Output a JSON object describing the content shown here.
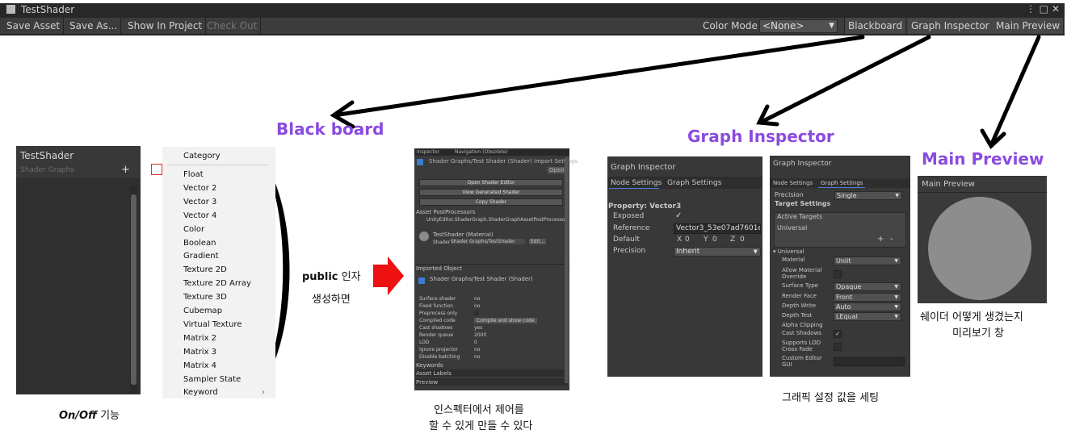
{
  "window": {
    "title": "TestShader"
  },
  "toolbar": {
    "save_asset": "Save Asset",
    "save_as": "Save As...",
    "show_in_project": "Show In Project",
    "check_out": "Check Out",
    "color_mode_label": "Color Mode",
    "color_mode_value": "<None>",
    "blackboard": "Blackboard",
    "graph_inspector": "Graph Inspector",
    "main_preview": "Main Preview"
  },
  "headings": {
    "blackboard": "Black board",
    "graph_inspector": "Graph Inspector",
    "main_preview": "Main Preview"
  },
  "blackboard_panel": {
    "title": "TestShader",
    "subtitle": "Shader Graphs",
    "add": "+"
  },
  "menu": {
    "header": "Category",
    "items": [
      "Float",
      "Vector 2",
      "Vector 3",
      "Vector 4",
      "Color",
      "Boolean",
      "Gradient",
      "Texture 2D",
      "Texture 2D Array",
      "Texture 3D",
      "Cubemap",
      "Virtual Texture",
      "Matrix 2",
      "Matrix 3",
      "Matrix 4",
      "Sampler State",
      "Keyword"
    ]
  },
  "annotations": {
    "onoff_bold": "On/Off",
    "onoff_rest": " 기능",
    "public_bold": "public",
    "public_rest": " 인자",
    "create": "생성하면",
    "inspector_caption1": "인스펙터에서 제어를",
    "inspector_caption2": "할 수 있게 만들 수 있다",
    "graph_caption": "그래픽 설정 값을 세팅",
    "preview_caption1": "쉐이더 어떻게 생겼는지",
    "preview_caption2": "미리보기 창"
  },
  "inspector": {
    "tab1": "Inspector",
    "tab2": "Navigation (Obsolete)",
    "header": "Shader Graphs/Test Shader (Shader) Import Settings",
    "open": "Open",
    "btn1": "Open Shader Editor",
    "btn2": "View Generated Shader",
    "btn3": "Copy Shader",
    "asset_pp": "Asset PostProcessors",
    "asset_pp_item": "UnityEditor.ShaderGraph.ShaderGraphAssetPostProcessor",
    "material": "TestShader (Material)",
    "shader_label": "Shader",
    "shader_value": "Shader Graphs/TestShader",
    "edit": "Edit...",
    "imported": "Imported Object",
    "imported_header": "Shader Graphs/Test Shader (Shader)",
    "props": [
      {
        "k": "Surface shader",
        "v": "no"
      },
      {
        "k": "Fixed function",
        "v": "no"
      },
      {
        "k": "Preprocess only",
        "v": ""
      },
      {
        "k": "Compiled code",
        "v": "Compile and show code"
      },
      {
        "k": "Cast shadows",
        "v": "yes"
      },
      {
        "k": "Render queue",
        "v": "2000"
      },
      {
        "k": "LOD",
        "v": "0"
      },
      {
        "k": "Ignore projector",
        "v": "no"
      },
      {
        "k": "Disable batching",
        "v": "no"
      }
    ],
    "keywords": "Keywords",
    "asset_labels": "Asset Labels",
    "preview": "Preview"
  },
  "gi1": {
    "title": "Graph Inspector",
    "tab_node": "Node Settings",
    "tab_graph": "Graph Settings",
    "property": "Property: Vector3",
    "exposed": "Exposed",
    "reference": "Reference",
    "reference_value": "Vector3_53e07ad7601e4",
    "default": "Default",
    "x": "X",
    "xv": "0",
    "y": "Y",
    "yv": "0",
    "z": "Z",
    "zv": "0",
    "precision": "Precision",
    "precision_value": "Inherit"
  },
  "gi2": {
    "title": "Graph Inspector",
    "tab_node": "Node Settings",
    "tab_graph": "Graph Settings",
    "precision": "Precision",
    "precision_value": "Single",
    "target_settings": "Target Settings",
    "active_targets": "Active Targets",
    "universal": "Universal",
    "plus": "+",
    "minus": "-",
    "universal_section": "Universal",
    "rows": [
      {
        "k": "Material",
        "v": "Unlit",
        "type": "dd"
      },
      {
        "k": "Allow Material Override",
        "v": "",
        "type": "chk"
      },
      {
        "k": "Surface Type",
        "v": "Opaque",
        "type": "dd"
      },
      {
        "k": "Render Face",
        "v": "Front",
        "type": "dd"
      },
      {
        "k": "Depth Write",
        "v": "Auto",
        "type": "dd"
      },
      {
        "k": "Depth Test",
        "v": "LEqual",
        "type": "dd"
      },
      {
        "k": "Alpha Clipping",
        "v": "",
        "type": "none"
      },
      {
        "k": "Cast Shadows",
        "v": "✓",
        "type": "chk"
      },
      {
        "k": "Supports LOD Cross Fade",
        "v": "",
        "type": "chk"
      },
      {
        "k": "Custom Editor GUI",
        "v": "",
        "type": "field"
      }
    ]
  },
  "preview_panel": {
    "title": "Main Preview"
  },
  "colors": {
    "purple": "#8a4be0",
    "panel": "#383838",
    "arrow_red": "#ee1111"
  }
}
